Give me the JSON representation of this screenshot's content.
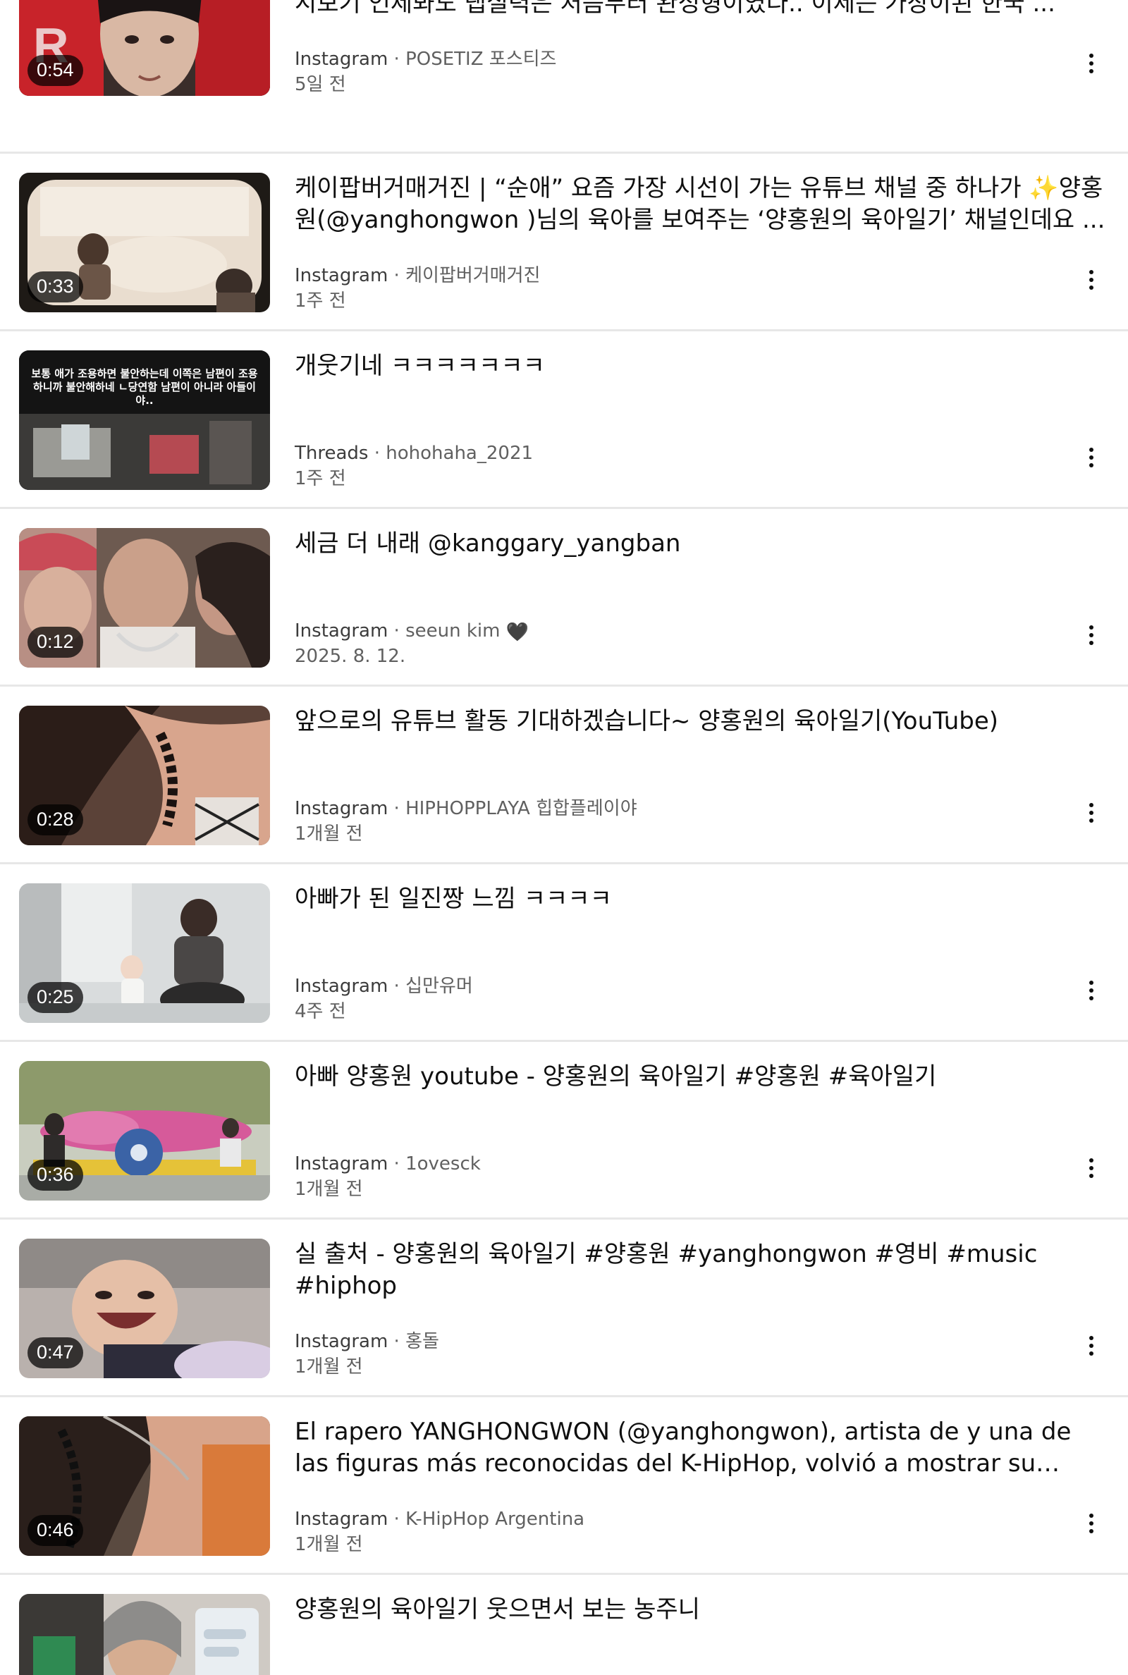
{
  "colors": {
    "background": "#ffffff",
    "title_text": "#0f0f0f",
    "meta_text": "#606060",
    "divider": "#e7e7e7",
    "duration_badge": "#000000"
  },
  "results": [
    {
      "duration": "0:54",
      "title": "요즘 핫한 아빠가 된 일진짱 양홍원 ㅋㅋ 떡잎부터 달랐던 고등래퍼 지원영상 다시보기 언제봐도 랩실력은 처음부터 완성형이였다.. 이제는 가장이된 한국 ...",
      "platform": "Instagram",
      "channel": "POSETIZ 포스티즈",
      "age": "5일 전"
    },
    {
      "duration": "0:33",
      "title": "케이팝버거매거진 | “순애” 요즘 가장 시선이 가는 유튜브 채널 중 하나가 ✨양홍원(@yanghongwon )님의 육아를 보여주는 ‘양홍원의 육아일기’ 채널인데요 ...",
      "platform": "Instagram",
      "channel": " 케이팝버거매거진",
      "age": "1주 전"
    },
    {
      "duration": "",
      "title": "개웃기네 ㅋㅋㅋㅋㅋㅋㅋ",
      "platform": "Threads",
      "channel": "hohohaha_2021",
      "age": "1주 전",
      "thumb_caption": "보통 애가 조용하면 불안하는데 이쪽은 남편이 조용하니까 불안해하네 ㄴ당연함 남편이 아니라 아들이야.."
    },
    {
      "duration": "0:12",
      "title": "세금 더 내래 @kanggary_yangban",
      "platform": "Instagram",
      "channel": "seeun kim",
      "channel_suffix": "🖤",
      "age": "2025. 8. 12."
    },
    {
      "duration": "0:28",
      "title": "앞으로의 유튜브 활동 기대하겠습니다~ 양홍원의 육아일기(YouTube)",
      "platform": "Instagram",
      "channel": "HIPHOPPLAYA 힙합플레이야",
      "age": "1개월 전"
    },
    {
      "duration": "0:25",
      "title": "아빠가 된 일진짱 느낌 ㅋㅋㅋㅋ",
      "platform": "Instagram",
      "channel": " 십만유머",
      "age": "4주 전"
    },
    {
      "duration": "0:36",
      "title": "아빠 양홍원 youtube - 양홍원의 육아일기 #양홍원 #육아일기",
      "platform": "Instagram",
      "channel": "1ovesck",
      "age": "1개월 전"
    },
    {
      "duration": "0:47",
      "title": "실 출처 - 양홍원의 육아일기 #양홍원 #yanghongwon #영비 #music #hiphop",
      "platform": "Instagram",
      "channel": " 홍돌",
      "age": "1개월 전"
    },
    {
      "duration": "0:46",
      "title": "El rapero YANGHONGWON (@yanghongwon), artista de y una de las figuras más reconocidas del K-HipHop, volvió a mostrar su faceta más...",
      "platform": "Instagram",
      "channel": "K-HipHop Argentina",
      "age": "1개월 전"
    },
    {
      "duration": "",
      "title": "양홍원의 육아일기 웃으면서 보는 농주니",
      "platform": "",
      "channel": "",
      "age": ""
    }
  ],
  "icons": {
    "more": "more-vertical-icon",
    "heart": "black-heart-icon"
  },
  "meta_separator": " · "
}
